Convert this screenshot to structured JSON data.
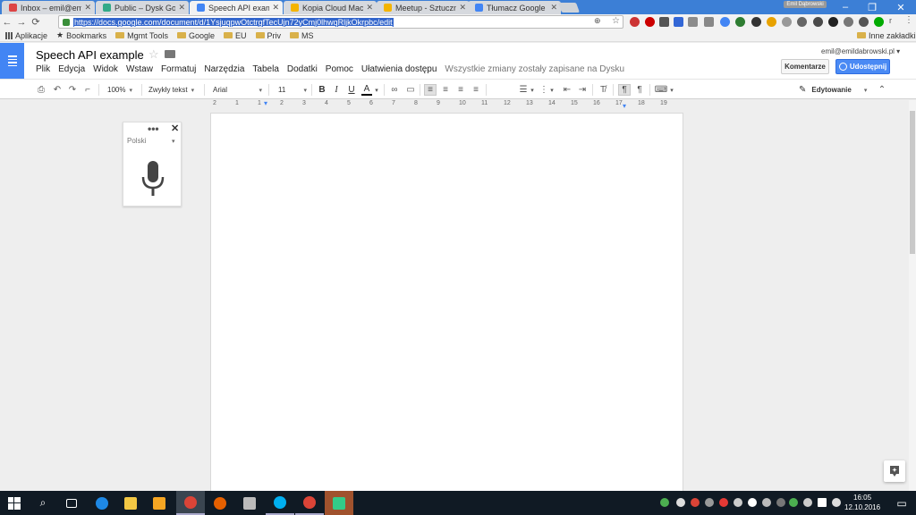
{
  "browser": {
    "tabs": [
      {
        "title": "Inbox – emil@emild",
        "color": "#d44"
      },
      {
        "title": "Public – Dysk Google",
        "color": "#3a8"
      },
      {
        "title": "Speech API example",
        "color": "#4285f4"
      },
      {
        "title": "Kopia Cloud Machi",
        "color": "#f4b400"
      },
      {
        "title": "Meetup - Sztuczna",
        "color": "#f4b400"
      },
      {
        "title": "Tłumacz Google",
        "color": "#4285f4"
      }
    ],
    "user_badge": "Emil Dąbrowski",
    "url": "https://docs.google.com/document/d/1YsjuqpwOtctrgfTecUjn72yCmj0lhwqRljkOkrpbc/edit",
    "bookmarks": [
      {
        "label": "Aplikacje",
        "type": "apps"
      },
      {
        "label": "Bookmarks",
        "type": "star"
      },
      {
        "label": "Mgmt Tools",
        "type": "folder"
      },
      {
        "label": "Google",
        "type": "folder"
      },
      {
        "label": "EU",
        "type": "folder"
      },
      {
        "label": "Priv",
        "type": "folder"
      },
      {
        "label": "MS",
        "type": "folder"
      }
    ],
    "other_bookmarks": "Inne zakładki"
  },
  "docs": {
    "title": "Speech API example",
    "menu": [
      "Plik",
      "Edycja",
      "Widok",
      "Wstaw",
      "Formatuj",
      "Narzędzia",
      "Tabela",
      "Dodatki",
      "Pomoc",
      "Ułatwienia dostępu"
    ],
    "saved_status": "Wszystkie zmiany zostały zapisane na Dysku",
    "account_email": "emil@emildabrowski.pl",
    "comments_button": "Komentarze",
    "share_button": "Udostępnij",
    "toolbar": {
      "zoom": "100%",
      "style": "Zwykły tekst",
      "font": "Arial",
      "size": "11",
      "bold": "B",
      "italic": "I",
      "underline": "U",
      "text_color": "A",
      "mode": "Edytowanie"
    },
    "ruler_ticks": [
      "2",
      "1",
      "1",
      "2",
      "3",
      "4",
      "5",
      "6",
      "7",
      "8",
      "9",
      "10",
      "11",
      "12",
      "13",
      "14",
      "15",
      "16",
      "17",
      "18",
      "19"
    ]
  },
  "voice_typing": {
    "menu": "•••",
    "close": "✕",
    "language": "Polski"
  },
  "taskbar": {
    "time": "16:05",
    "date": "12.10.2016"
  }
}
